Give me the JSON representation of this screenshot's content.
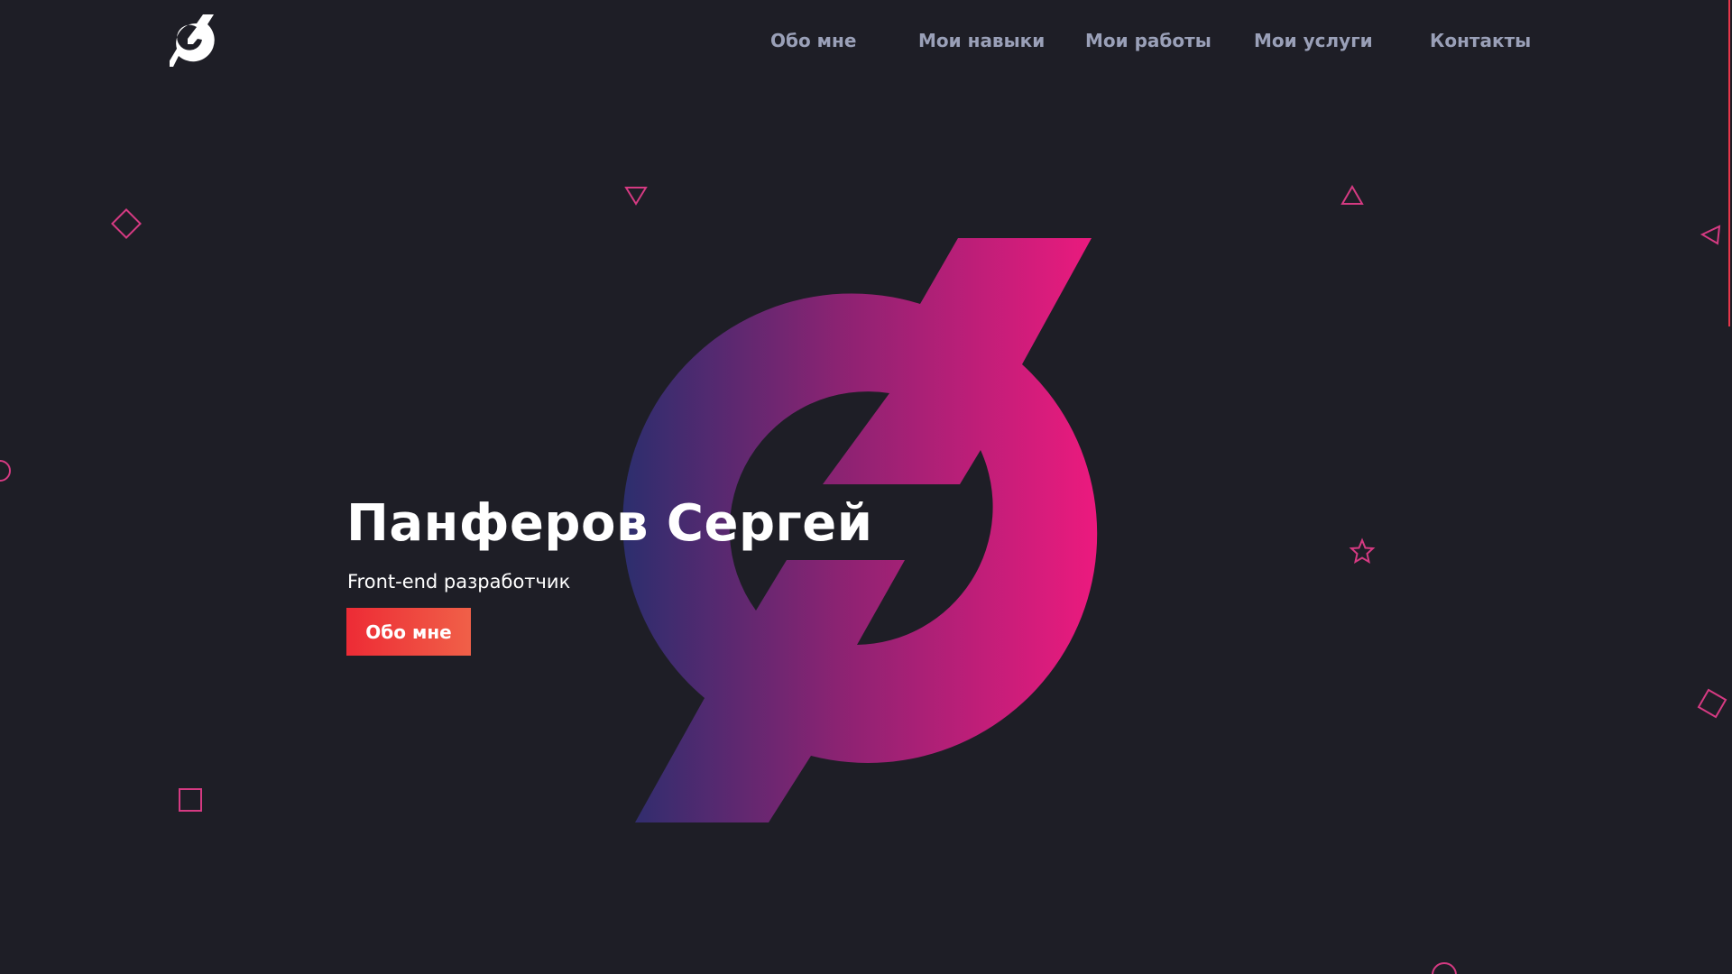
{
  "header": {
    "logo_icon": "stylized-s-lightning-logo",
    "nav": [
      {
        "label": "Обо мне"
      },
      {
        "label": "Мои навыки"
      },
      {
        "label": "Мои работы"
      },
      {
        "label": "Мои услуги"
      },
      {
        "label": "Контакты"
      }
    ]
  },
  "hero": {
    "title": "Панферов Сергей",
    "subtitle": "Front-end разработчик",
    "button_label": "Обо мне"
  },
  "decorations": {
    "shapes": [
      "diamond-icon",
      "triangle-down-icon",
      "triangle-up-icon",
      "triangle-left-icon",
      "circle-icon",
      "star-icon",
      "square-icon"
    ]
  },
  "colors": {
    "background": "#1e1e26",
    "nav_text": "#9aa0b8",
    "accent_pink": "#e01e7f",
    "accent_red": "#ed2b35",
    "gradient_start": "#2c2e6e",
    "gradient_end": "#ec1a7e",
    "decoration_stroke": "#d53a82"
  }
}
